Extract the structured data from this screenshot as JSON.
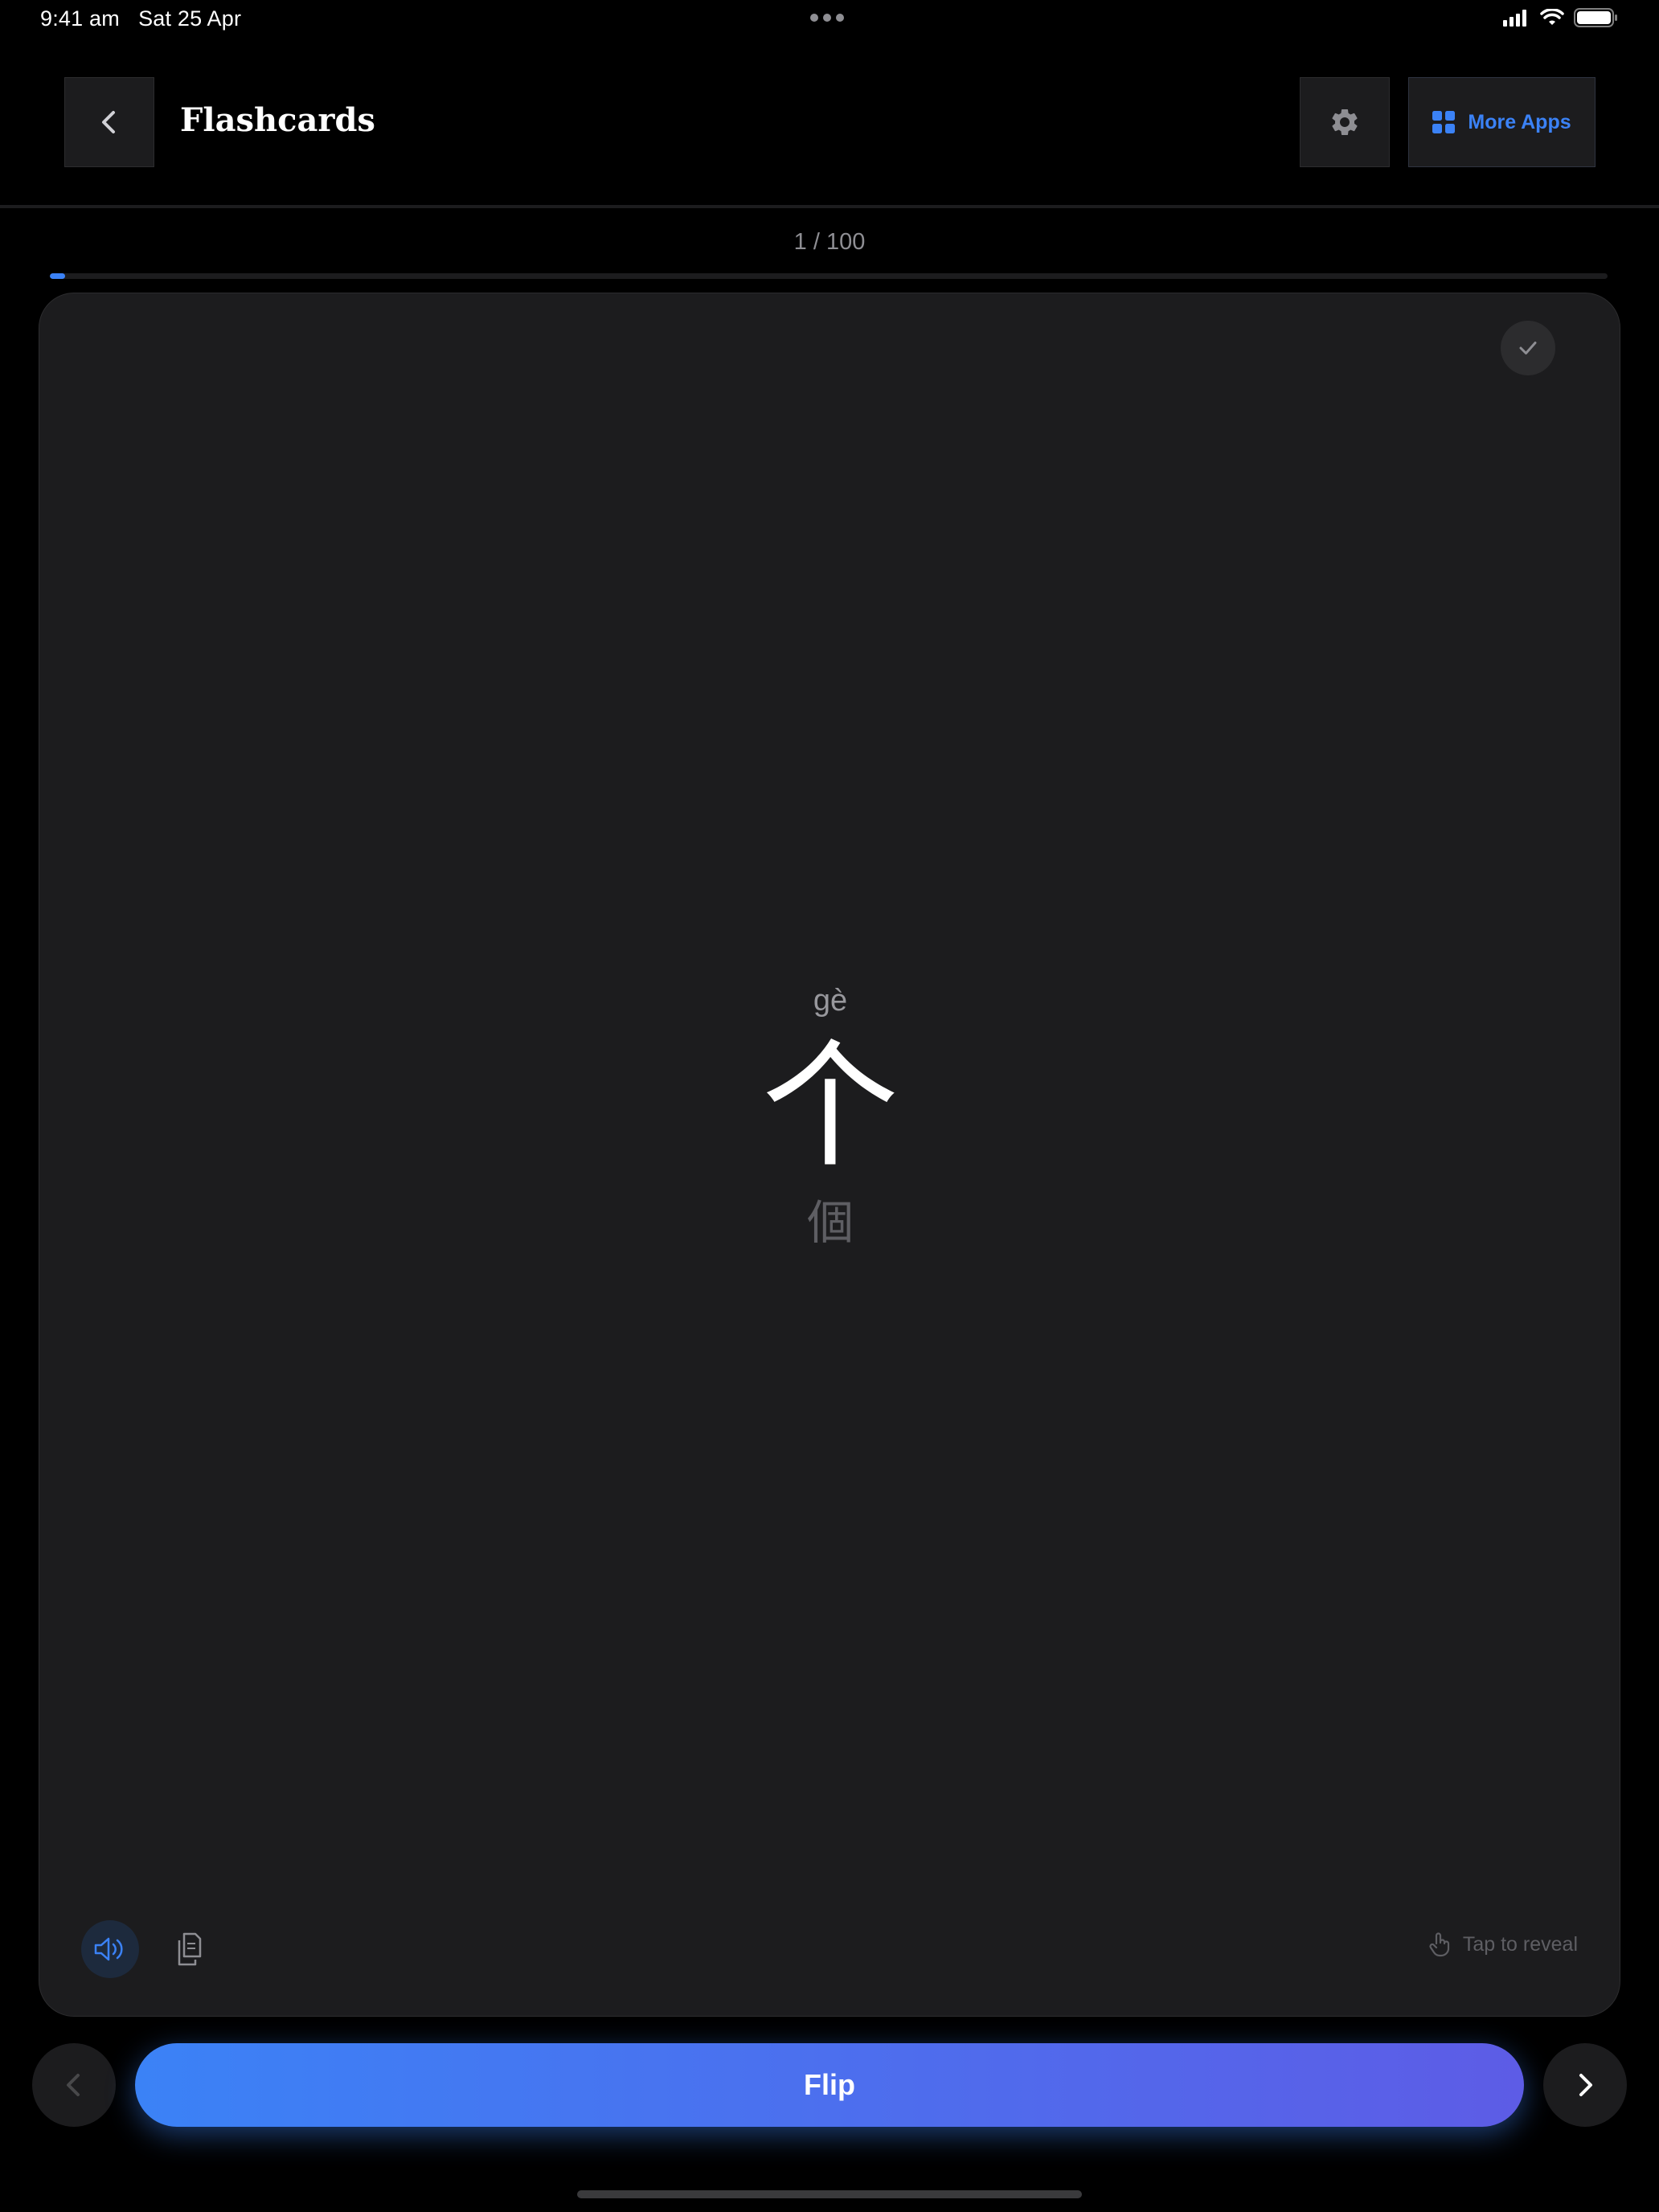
{
  "status_bar": {
    "time": "9:41 am",
    "date": "Sat 25 Apr",
    "icons": [
      "signal-icon",
      "wifi-icon",
      "battery-icon"
    ]
  },
  "header": {
    "back_icon": "chevron-left-icon",
    "title": "Flashcards",
    "settings_icon": "gear-icon",
    "more_apps_icon": "grid-icon",
    "more_apps_label": "More Apps"
  },
  "progress": {
    "text": "1 / 100",
    "current": 1,
    "total": 100,
    "fraction": 0.01
  },
  "card": {
    "pinyin": "gè",
    "simplified": "个",
    "traditional": "個",
    "known_icon": "checkmark-icon",
    "speaker_icon": "speaker-icon",
    "copy_icon": "copy-icon",
    "tap_hint_icon": "tap-hand-icon",
    "tap_hint": "Tap to reveal"
  },
  "controls": {
    "prev_icon": "chevron-left-icon",
    "flip_label": "Flip",
    "next_icon": "chevron-right-icon"
  },
  "colors": {
    "accent": "#3b82f6",
    "gradient_end": "#5d5ce6",
    "card_bg": "#1c1c1e",
    "page_bg": "#000000"
  }
}
